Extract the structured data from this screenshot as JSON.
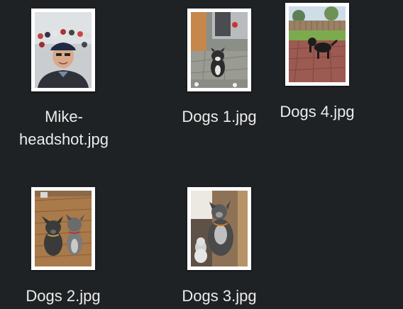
{
  "files": [
    {
      "id": "mike-headshot",
      "name_line1": "Mike-",
      "name_line2": "headshot.jpg"
    },
    {
      "id": "dogs-1",
      "name": "Dogs 1.jpg"
    },
    {
      "id": "dogs-4",
      "name": "Dogs 4.jpg"
    },
    {
      "id": "dogs-2",
      "name": "Dogs 2.jpg"
    },
    {
      "id": "dogs-3",
      "name": "Dogs 3.jpg"
    }
  ],
  "colors": {
    "background": "#1f2224",
    "label_text": "#ececec",
    "thumbnail_border": "#ffffff"
  }
}
